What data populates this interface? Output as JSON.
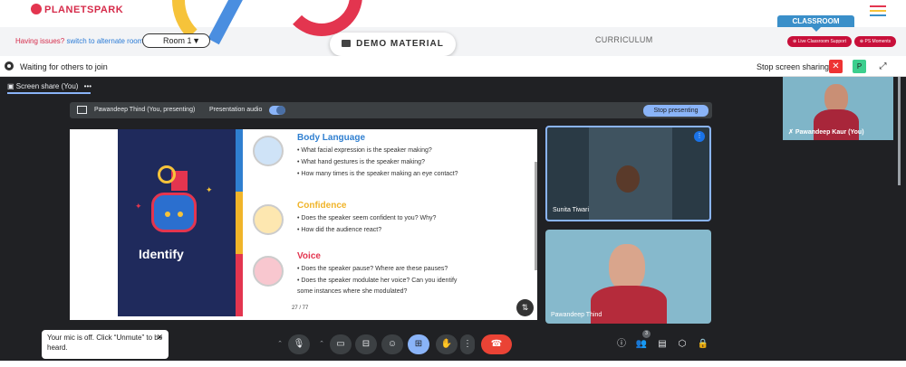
{
  "header": {
    "logo": "PLANETSPARK",
    "issues_text": "Having issues?",
    "issues_link": "switch to alternate room",
    "room_select": "Room 1",
    "demo_material": "DEMO MATERIAL",
    "curriculum": "CURRICULUM",
    "classroom": "CLASSROOM",
    "live_support": "Live Classroom Support",
    "ps_moments": "PS Moments",
    "accent_colors": [
      "#d62b4a",
      "#3a8fc9",
      "#f6c33a"
    ]
  },
  "waitbar": {
    "status": "Waiting for others to join",
    "stop_sharing": "Stop screen sharing",
    "close_glyph": "✕",
    "p_label": "P",
    "expand_glyph": "⤢"
  },
  "meet": {
    "screen_share_label": "Screen share (You)",
    "dots": "•••",
    "presenter": "Pawandeep Thind (You, presenting)",
    "presentation_audio": "Presentation audio",
    "stop_presenting": "Stop presenting",
    "prev_glyph": "❮",
    "next_glyph": "❯",
    "slide": {
      "identify": "Identify",
      "page": "27 / 77",
      "sections": [
        {
          "title": "Body Language",
          "color": "#2f7fd0",
          "bullets": [
            "• What facial expression is the speaker making?",
            "• What hand gestures is the speaker making?",
            "• How many times is the speaker making an eye contact?"
          ]
        },
        {
          "title": "Confidence",
          "color": "#f0b429",
          "bullets": [
            "• Does the speaker seem confident to you? Why?",
            "• How did the audience react?"
          ]
        },
        {
          "title": "Voice",
          "color": "#e3354f",
          "bullets": [
            "• Does the speaker pause? Where are these pauses?",
            "• Does the speaker modulate her voice? Can you identify",
            "  some instances where she modulated?"
          ]
        }
      ]
    },
    "tiles": {
      "self_name": "Pawandeep Kaur (You)",
      "tile1_name": "Sunita Tiwari",
      "tile2_name": "Pawandeep Thind"
    },
    "toast": {
      "message": "Your mic is off. Click “Unmute” to be heard.",
      "close": "✕"
    },
    "participants_count": "3",
    "icons": [
      "gear-icon",
      "mic-icon",
      "camera-icon",
      "captions-icon",
      "emoji-icon",
      "present-icon",
      "hand-icon",
      "more-icon",
      "hangup-icon",
      "info-icon",
      "people-icon",
      "chat-icon",
      "activities-icon",
      "lock-icon"
    ]
  }
}
